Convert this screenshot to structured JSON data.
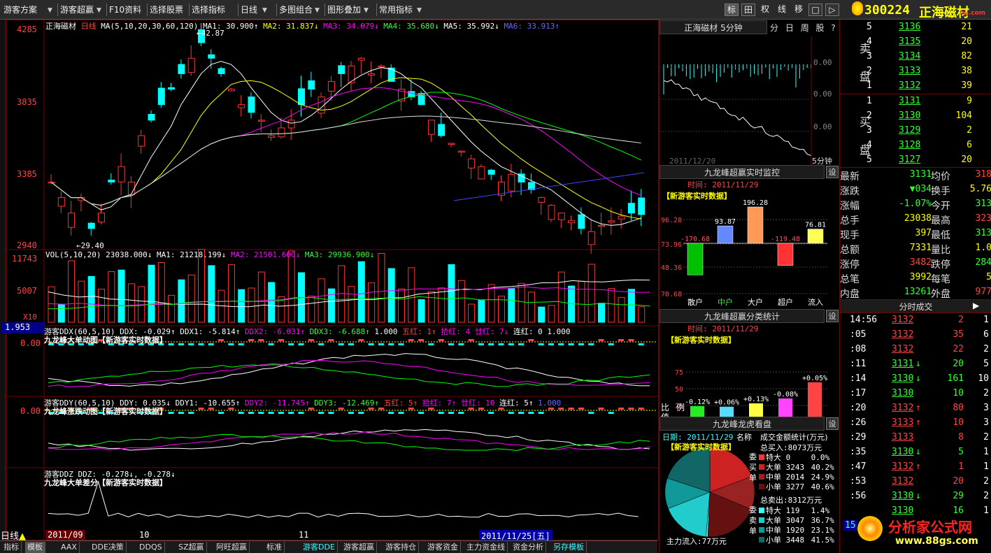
{
  "toolbar": {
    "items": [
      "游客方案",
      "游客超赢",
      "F10资料",
      "选择股票",
      "选择指标",
      "日线",
      "多图组合",
      "图形叠加",
      "常用指标"
    ],
    "buttons": [
      "标",
      "田",
      "权",
      "线",
      "移",
      "□",
      "▷"
    ],
    "stock_code": "300224",
    "stock_name": "正海磁材",
    "watermark": "fxj.com"
  },
  "main_chart": {
    "title_name": "正海磁材",
    "period": "日线",
    "ma_label": "MA(5,10,20,30,60,120)",
    "ma1": "MA1: 30.900↑",
    "ma2": "MA2: 31.837↓",
    "ma3": "MA3: 34.079↓",
    "ma4": "MA4: 35.680↓",
    "ma5": "MA5: 35.992↓",
    "ma6": "MA6: 33.913↑",
    "y_ticks": [
      "4285",
      "3835",
      "3385",
      "2940"
    ],
    "high_annot": "42.87",
    "low_annot": "29.40",
    "colors": {
      "up": "#ff3333",
      "down": "#00ffff",
      "ma1": "#ffffff",
      "ma2": "#ffff00",
      "ma3": "#ff00ff",
      "ma4": "#00ff00"
    }
  },
  "vol_panel": {
    "label": "VOL(5,10,20)",
    "vol": "23038.000↓",
    "ma1": "MA1: 21218.199↓",
    "ma2": "MA2: 21501.600↓",
    "ma3": "MA3: 29936.900↓",
    "y_ticks": [
      "11743",
      "5007"
    ],
    "unit": "X10",
    "side_value": "1.953"
  },
  "ddx_panel": {
    "label": "游客DDX(60,5,10)",
    "ddx": "DDX: -0.029↑",
    "ddx1": "DDX1: -5.814↑",
    "ddx2": "DDX2: -6.031↑",
    "ddx3": "DDX3: -6.688↑",
    "val": "1.000",
    "wuhong": "五红: 1↑",
    "shihong": "拾红: 4",
    "nianhong": "廿红: 7↓",
    "lianhong": "连红: 0",
    "val2": "1.000",
    "sub": "九龙峰大单动图【新游客实时数据】",
    "zero": "0.00"
  },
  "ddy_panel": {
    "label": "游客DDY(60,5,10)",
    "ddy": "DDY: 0.035↓",
    "ddy1": "DDY1: -10.655↑",
    "ddy2": "DDY2: -11.745↑",
    "ddy3": "DDY3: -12.469↑",
    "wuhong": "五红: 5↑",
    "shihong": "拾红: 7↑",
    "nianhong": "廿红: 10",
    "lianhong": "连红: 5↑",
    "val": "1.000",
    "sub": "九龙峰涨跌动图【新游客实时数据】",
    "zero": "0.00"
  },
  "ddz_panel": {
    "label": "游客DDZ",
    "ddz": "DDZ: -0.278↓, -0.278↓",
    "sub": "九龙峰大单差分【新游客实时数据】"
  },
  "date_axis": {
    "period": "日线",
    "ticks": [
      "2011/09",
      "10",
      "11"
    ],
    "cursor_date": "2011/11/25[五]"
  },
  "bottom_tabs": [
    "指标",
    "模板",
    "AAX",
    "DDE决策",
    "DDQS",
    "SZ超赢",
    "阿旺超赢",
    "标准",
    "游客DDE",
    "游客超赢",
    "游客持仓",
    "游客资金",
    "主力资金线",
    "资金分析",
    "另存模板"
  ],
  "minute_chart": {
    "title": "正海磁材 5分钟",
    "tabs": [
      "分",
      "日",
      "周",
      "股",
      "?"
    ],
    "y_ticks": [
      "0.00",
      "0.00",
      "0.00",
      "0.00"
    ],
    "date": "2011/12/20",
    "period": "5分钟"
  },
  "monitor": {
    "title": "九龙峰超赢实时监控",
    "set": "设",
    "time": "时间: 2011/11/29",
    "sub": "【新游客实时数据】",
    "y_ticks": [
      "96.28",
      "73.96",
      "48.36",
      "70.68"
    ],
    "bars": [
      {
        "label": "散户",
        "value": "-170.68",
        "color": "#00c000"
      },
      {
        "label": "中户",
        "value": "93.87",
        "color": "#6688ff"
      },
      {
        "label": "大户",
        "value": "196.28",
        "color": "#ff9955"
      },
      {
        "label": "超户",
        "value": "-119.48",
        "color": "#ff3333"
      },
      {
        "label": "流入",
        "value": "76.81",
        "color": "#ffff55"
      }
    ]
  },
  "classify": {
    "title": "九龙峰超赢分类统计",
    "set": "设",
    "time": "时间: 2011/11/29",
    "sub": "【新游客实时数据】",
    "y_ticks": [
      "75",
      "50",
      "25"
    ],
    "bars": [
      {
        "pct": "-0.12%",
        "value": "21.12",
        "label": "散户",
        "color": "#22ee22"
      },
      {
        "pct": "+0.06%",
        "value": "20.14",
        "label": "中户",
        "color": "#55ddff"
      },
      {
        "pct": "+0.13%",
        "value": "25.50",
        "label": "大户",
        "color": "#ffff44"
      },
      {
        "pct": "-0.08%",
        "value": "33.24",
        "label": "超户",
        "color": "#ff44ff"
      },
      {
        "pct": "+0.05%",
        "value": "58.73",
        "label": "主力",
        "color": "#ff4444"
      }
    ],
    "left_labels": [
      "比",
      "例",
      "值"
    ]
  },
  "dragon": {
    "title": "九龙峰龙虎看盘",
    "set": "设",
    "date": "日期: 2011/11/29",
    "name_lbl": "名称",
    "stat_title": "成交金额统计(万元)",
    "sub": "【新游客实时数据】",
    "buy_total": "总买入:8073万元",
    "buy_label": [
      "委",
      "买",
      "单"
    ],
    "sell_label": [
      "委",
      "卖",
      "单"
    ],
    "buy_rows": [
      {
        "k": "特大",
        "v": "0",
        "p": "0.0%",
        "c": "#ff3333"
      },
      {
        "k": "大单",
        "v": "3243",
        "p": "40.2%",
        "c": "#cc2222"
      },
      {
        "k": "中单",
        "v": "2014",
        "p": "24.9%",
        "c": "#992222"
      },
      {
        "k": "小单",
        "v": "3277",
        "p": "40.6%",
        "c": "#661111"
      }
    ],
    "sell_total": "总卖出:8312万元",
    "sell_rows": [
      {
        "k": "特大",
        "v": "119",
        "p": "1.4%",
        "c": "#33ffff"
      },
      {
        "k": "大单",
        "v": "3047",
        "p": "36.7%",
        "c": "#22cccc"
      },
      {
        "k": "中单",
        "v": "1920",
        "p": "23.1%",
        "c": "#119999"
      },
      {
        "k": "小单",
        "v": "3448",
        "p": "41.5%",
        "c": "#116666"
      }
    ],
    "main_inflow": "主力流入:77万元"
  },
  "orderbook": {
    "sell_label": [
      "卖",
      "盘"
    ],
    "buy_label": [
      "买",
      "盘"
    ],
    "sells": [
      {
        "n": "5",
        "p": "3136",
        "v": "21"
      },
      {
        "n": "4",
        "p": "3135",
        "v": "20"
      },
      {
        "n": "3",
        "p": "3134",
        "v": "82"
      },
      {
        "n": "2",
        "p": "3133",
        "v": "38"
      },
      {
        "n": "1",
        "p": "3132",
        "v": "39"
      }
    ],
    "buys": [
      {
        "n": "1",
        "p": "3131",
        "v": "9"
      },
      {
        "n": "2",
        "p": "3130",
        "v": "104"
      },
      {
        "n": "3",
        "p": "3129",
        "v": "2"
      },
      {
        "n": "4",
        "p": "3128",
        "v": "6"
      },
      {
        "n": "5",
        "p": "3127",
        "v": "20"
      }
    ]
  },
  "stats": [
    {
      "l": "最新",
      "v": "3131",
      "vc": "#33ff33",
      "l2": "均价",
      "v2": "318",
      "v2c": "#ff4444"
    },
    {
      "l": "涨跌",
      "v": "▼034",
      "vc": "#33ff33",
      "l2": "换手",
      "v2": "5.76",
      "v2c": "#ffff00"
    },
    {
      "l": "涨幅",
      "v": "-1.07%",
      "vc": "#33ff33",
      "l2": "今开",
      "v2": "313",
      "v2c": "#33ff33"
    },
    {
      "l": "总手",
      "v": "23038",
      "vc": "#ffff00",
      "l2": "最高",
      "v2": "323",
      "v2c": "#ff4444"
    },
    {
      "l": "现手",
      "v": "397",
      "vc": "#ffff00",
      "l2": "最低",
      "v2": "313",
      "v2c": "#33ff33"
    },
    {
      "l": "总额",
      "v": "7331",
      "vc": "#ffff00",
      "l2": "量比",
      "v2": "1.0",
      "v2c": "#ffff00"
    },
    {
      "l": "涨停",
      "v": "3482",
      "vc": "#ff4444",
      "l2": "跌停",
      "v2": "284",
      "v2c": "#33ff33"
    },
    {
      "l": "总笔",
      "v": "3992",
      "vc": "#ffff00",
      "l2": "每笔",
      "v2": "5",
      "v2c": "#ffff00"
    },
    {
      "l": "内盘",
      "v": "13261",
      "vc": "#33ff33",
      "l2": "外盘",
      "v2": "977",
      "v2c": "#ff4444"
    }
  ],
  "ticks": {
    "title": "分时成交",
    "rows": [
      {
        "t": "14:56",
        "p": "3132",
        "a": "",
        "v": "2",
        "pc": "#ff4444",
        "vc": "#ff4444",
        "s": "1"
      },
      {
        "t": ":05",
        "p": "3132",
        "a": "",
        "v": "35",
        "pc": "#ff4444",
        "vc": "#ff4444",
        "s": "6"
      },
      {
        "t": ":08",
        "p": "3132",
        "a": "",
        "v": "22",
        "pc": "#ff4444",
        "vc": "#ff4444",
        "s": "2"
      },
      {
        "t": ":11",
        "p": "3131",
        "a": "↓",
        "v": "20",
        "pc": "#33ff33",
        "vc": "#33ff33",
        "s": "5"
      },
      {
        "t": ":14",
        "p": "3130",
        "a": "↓",
        "v": "161",
        "pc": "#33ff33",
        "vc": "#33ff33",
        "s": "10"
      },
      {
        "t": ":17",
        "p": "3130",
        "a": "",
        "v": "10",
        "pc": "#33ff33",
        "vc": "#33ff33",
        "s": "2"
      },
      {
        "t": ":20",
        "p": "3132",
        "a": "↑",
        "v": "80",
        "pc": "#ff4444",
        "vc": "#ff4444",
        "s": "3"
      },
      {
        "t": ":26",
        "p": "3133",
        "a": "↑",
        "v": "10",
        "pc": "#ff4444",
        "vc": "#ff4444",
        "s": "3"
      },
      {
        "t": ":29",
        "p": "3133",
        "a": "",
        "v": "8",
        "pc": "#ff4444",
        "vc": "#ff4444",
        "s": "2"
      },
      {
        "t": ":35",
        "p": "3130",
        "a": "↓",
        "v": "5",
        "pc": "#33ff33",
        "vc": "#33ff33",
        "s": "1"
      },
      {
        "t": ":47",
        "p": "3132",
        "a": "↑",
        "v": "1",
        "pc": "#ff4444",
        "vc": "#ff4444",
        "s": "1"
      },
      {
        "t": ":53",
        "p": "3132",
        "a": "",
        "v": "20",
        "pc": "#ff4444",
        "vc": "#ff4444",
        "s": "2"
      },
      {
        "t": ":56",
        "p": "3130",
        "a": "↓",
        "v": "29",
        "pc": "#33ff33",
        "vc": "#33ff33",
        "s": "2"
      },
      {
        "t": "",
        "p": "3130",
        "a": "",
        "v": "16",
        "pc": "#33ff33",
        "vc": "#33ff33",
        "s": "1"
      }
    ]
  },
  "brand": {
    "text": "分析家公式网",
    "url": "www.88gs.com",
    "num": "15"
  }
}
